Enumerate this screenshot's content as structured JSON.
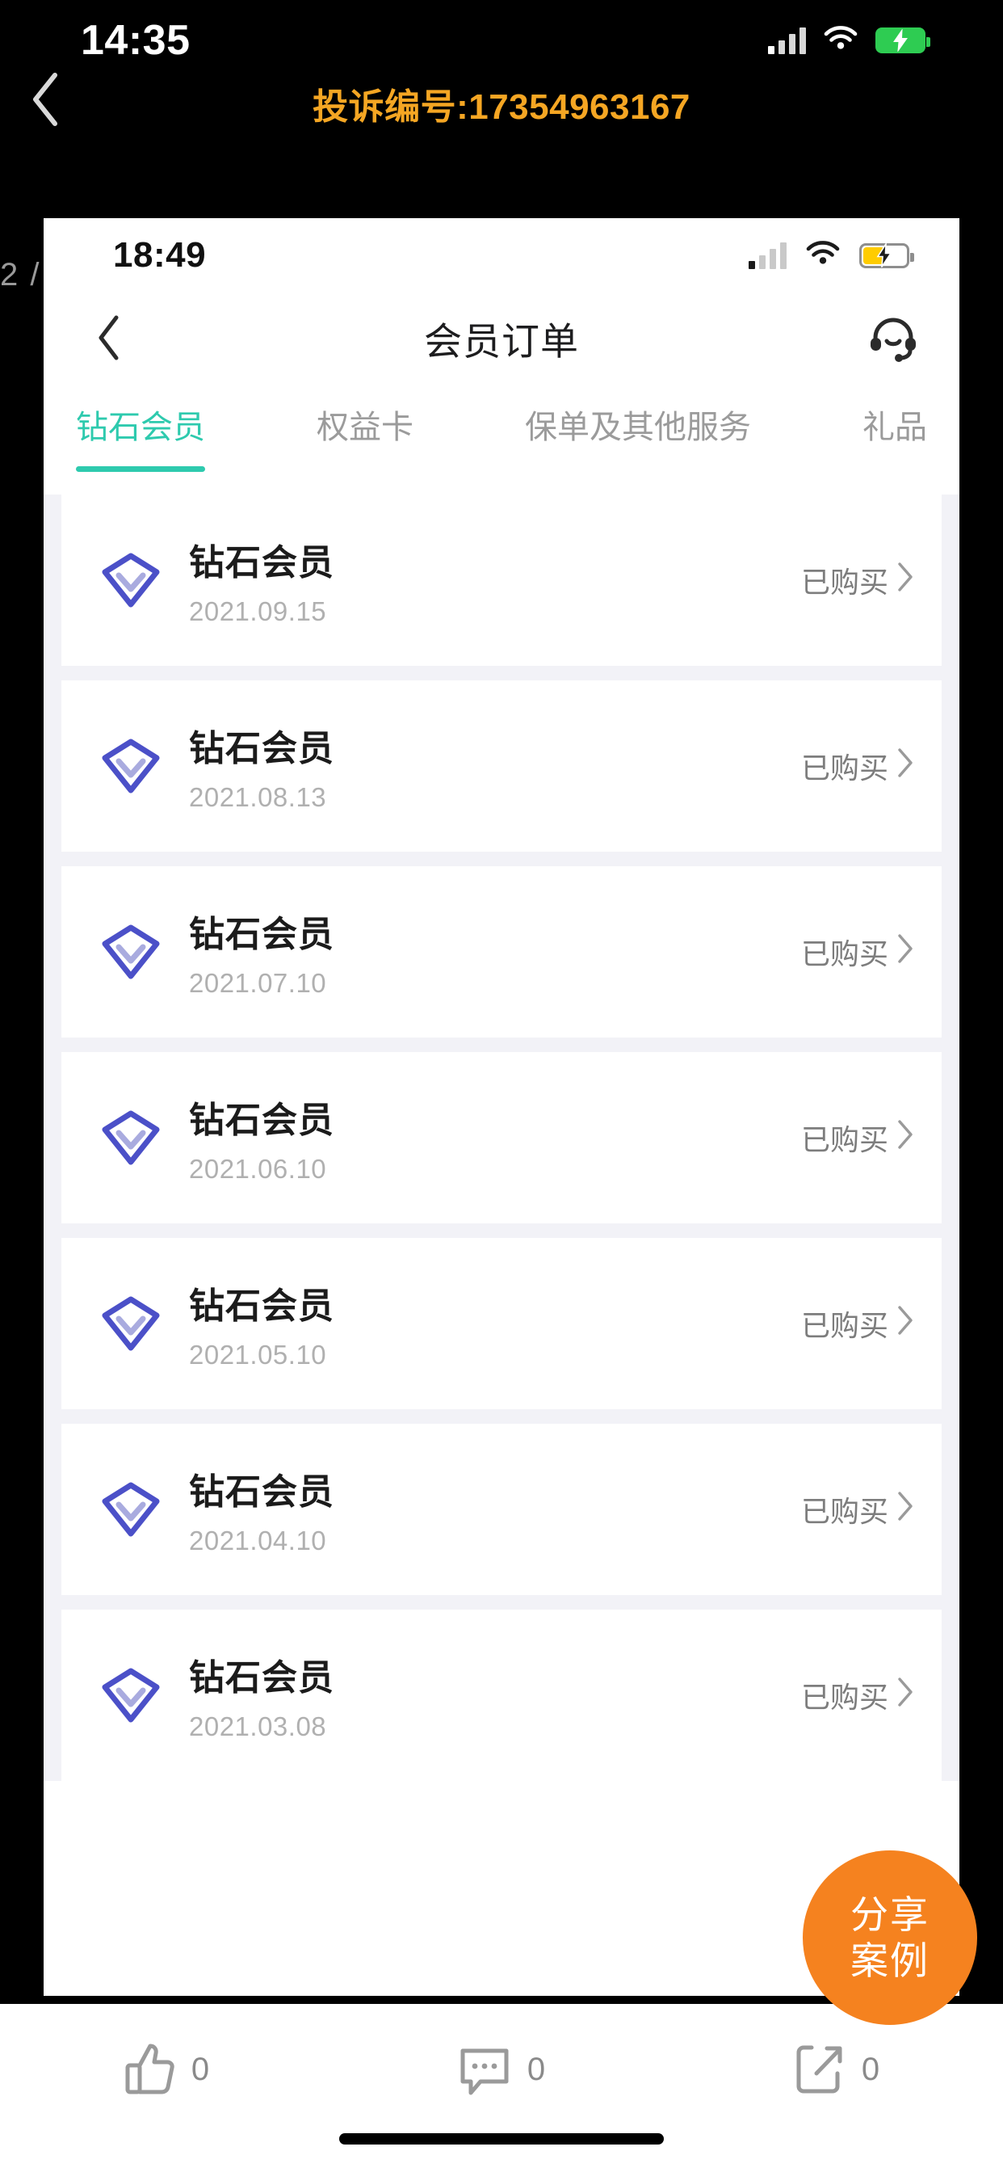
{
  "os_status": {
    "time": "14:35",
    "signal_icon": "signal-bars-icon",
    "wifi_icon": "wifi-icon",
    "battery_icon": "battery-charging-icon"
  },
  "outer_nav": {
    "back_icon": "back-chevron-icon",
    "title": "投诉编号:17354963167"
  },
  "page_counter": "2 /",
  "inner_screenshot": {
    "status_bar": {
      "time": "18:49",
      "signal_icon": "signal-bars-icon",
      "wifi_icon": "wifi-icon",
      "battery_icon": "battery-charging-icon"
    },
    "nav": {
      "back_icon": "back-chevron-icon",
      "title": "会员订单",
      "support_icon": "headset-support-icon"
    },
    "tabs": [
      {
        "label": "钻石会员",
        "active": true
      },
      {
        "label": "权益卡",
        "active": false
      },
      {
        "label": "保单及其他服务",
        "active": false
      },
      {
        "label": "礼品",
        "active": false
      }
    ],
    "orders": [
      {
        "icon": "diamond-icon",
        "title": "钻石会员",
        "date": "2021.09.15",
        "status": "已购买"
      },
      {
        "icon": "diamond-icon",
        "title": "钻石会员",
        "date": "2021.08.13",
        "status": "已购买"
      },
      {
        "icon": "diamond-icon",
        "title": "钻石会员",
        "date": "2021.07.10",
        "status": "已购买"
      },
      {
        "icon": "diamond-icon",
        "title": "钻石会员",
        "date": "2021.06.10",
        "status": "已购买"
      },
      {
        "icon": "diamond-icon",
        "title": "钻石会员",
        "date": "2021.05.10",
        "status": "已购买"
      },
      {
        "icon": "diamond-icon",
        "title": "钻石会员",
        "date": "2021.04.10",
        "status": "已购买"
      },
      {
        "icon": "diamond-icon",
        "title": "钻石会员",
        "date": "2021.03.08",
        "status": "已购买"
      }
    ]
  },
  "share_fab": {
    "line1": "分享",
    "line2": "案例",
    "color": "#f5821f"
  },
  "bottom_bar": {
    "like": {
      "icon": "thumbs-up-icon",
      "count": "0"
    },
    "comment": {
      "icon": "comment-icon",
      "count": "0"
    },
    "share": {
      "icon": "share-icon",
      "count": "0"
    }
  },
  "colors": {
    "accent_orange": "#f5a623",
    "tab_active": "#2ecaae",
    "diamond_blue": "#4b50c8",
    "fab_orange": "#f5821f",
    "page_bg": "#f2f2f7"
  }
}
